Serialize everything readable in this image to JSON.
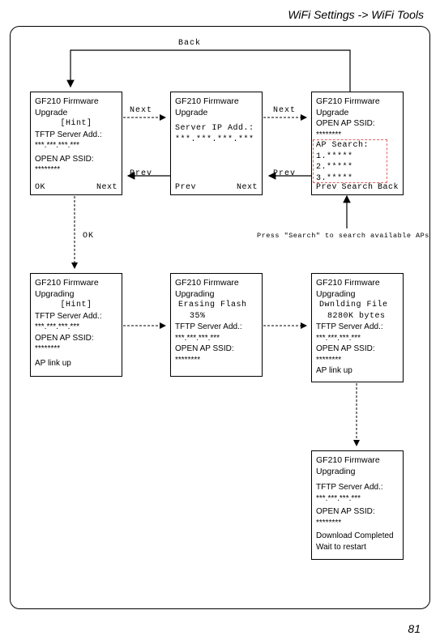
{
  "header": "WiFi Settings -> WiFi Tools",
  "page_number": "81",
  "labels": {
    "back": "Back",
    "next1": "Next",
    "prev1": "Prev",
    "next2": "Next",
    "prev2": "Prev",
    "ok": "OK"
  },
  "note": "Press  \"Search\"  to search available APs",
  "box1": {
    "l1": "GF210 Firmware",
    "l2": " Upgrade",
    "hint": "[Hint]",
    "l3": "TFTP Server Add.:",
    "l4": "***.***.***.***",
    "l5": "OPEN AP SSID:",
    "l6": "********",
    "foot_left": "OK",
    "foot_right": "Next"
  },
  "box2": {
    "l1": "GF210 Firmware",
    "l2": " Upgrade",
    "l3": "Server IP Add.:",
    "l4": "***.***.***.***",
    "foot_left": "Prev",
    "foot_right": "Next"
  },
  "box3": {
    "l1": "GF210 Firmware",
    "l2": " Upgrade",
    "l3": "OPEN AP SSID:",
    "l4": "********",
    "l5": "AP Search:",
    "l6": "1.*****",
    "l7": "2.*****",
    "l8": "3.*****",
    "foot_left": "Prev",
    "foot_mid": "Search",
    "foot_right": "Back"
  },
  "box4": {
    "l1": "GF210 Firmware",
    "l2": " Upgrading",
    "hint": "[Hint]",
    "l3": "TFTP Server Add.:",
    "l4": "***.***.***.***",
    "l5": "OPEN AP SSID:",
    "l6": "********",
    "l7": "AP link up"
  },
  "box5": {
    "l1": "GF210 Firmware",
    "l2": " Upgrading",
    "l3": "Erasing Flash",
    "l4": "35%",
    "l5": "TFTP Server Add.:",
    "l6": "***.***.***.***",
    "l7": "OPEN AP SSID:",
    "l8": "********"
  },
  "box6": {
    "l1": "GF210 Firmware",
    "l2": " Upgrading",
    "l3": "Dwnlding File",
    "l4": "8280K bytes",
    "l5": "TFTP Server Add.:",
    "l6": "***.***.***.***",
    "l7": "OPEN AP SSID:",
    "l8": "********",
    "l9": "  AP link up"
  },
  "box7": {
    "l1": "GF210 Firmware",
    "l2": " Upgrading",
    "l3": "TFTP Server Add.:",
    "l4": "***.***.***.***",
    "l5": "OPEN AP SSID:",
    "l6": "********",
    "l7": "Download Completed",
    "l8": "Wait to restart"
  }
}
